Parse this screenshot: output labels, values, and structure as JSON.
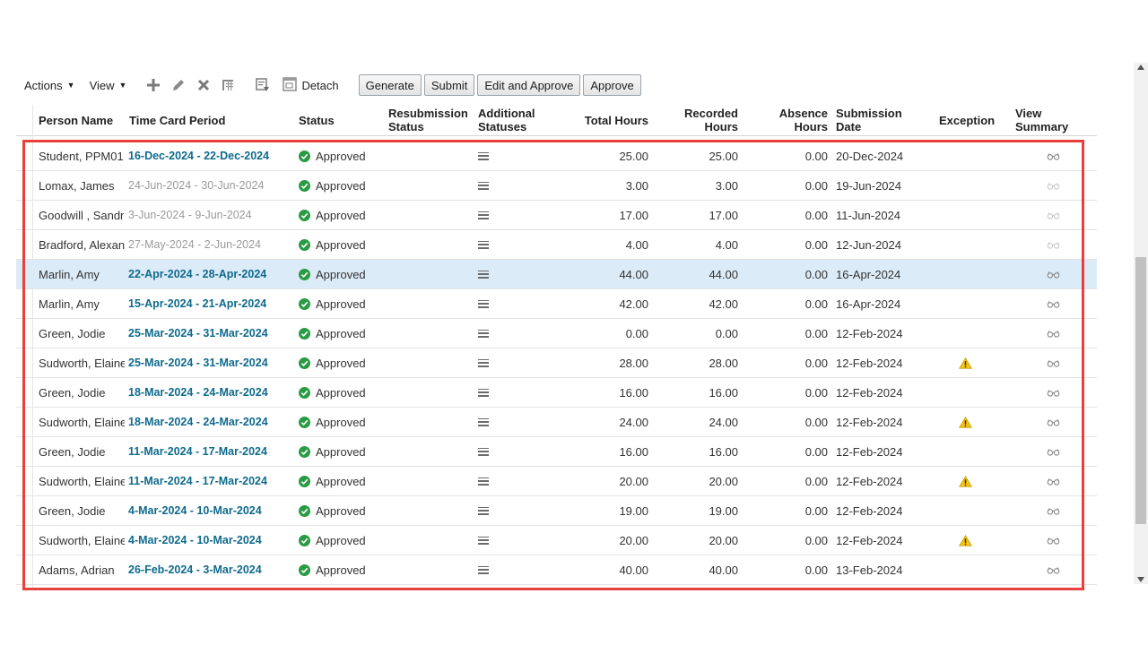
{
  "toolbar": {
    "actions_label": "Actions",
    "view_label": "View",
    "detach_label": "Detach",
    "buttons": {
      "generate": "Generate",
      "submit": "Submit",
      "edit_approve": "Edit and Approve",
      "approve": "Approve"
    },
    "icons": [
      "add-icon",
      "edit-icon",
      "delete-icon",
      "freeze-icon",
      "export-icon",
      "detach-icon"
    ]
  },
  "table": {
    "headers": {
      "person": "Person Name",
      "period": "Time Card Period",
      "status": "Status",
      "resub_1": "Resubmission",
      "resub_2": "Status",
      "addl_1": "Additional",
      "addl_2": "Statuses",
      "total": "Total Hours",
      "recorded_1": "Recorded",
      "recorded_2": "Hours",
      "absence_1": "Absence",
      "absence_2": "Hours",
      "subdate_1": "Submission",
      "subdate_2": "Date",
      "exception": "Exception",
      "summary": "View Summary"
    },
    "rows": [
      {
        "person": "Student, PPM01",
        "period": "16-Dec-2024 - 22-Dec-2024",
        "status": "Approved",
        "total": "25.00",
        "recorded": "25.00",
        "absence": "0.00",
        "date": "20-Dec-2024",
        "exception": false,
        "muted_period": false,
        "selected": false,
        "summary_dim": false
      },
      {
        "person": "Lomax, James",
        "period": "24-Jun-2024 - 30-Jun-2024",
        "status": "Approved",
        "total": "3.00",
        "recorded": "3.00",
        "absence": "0.00",
        "date": "19-Jun-2024",
        "exception": false,
        "muted_period": true,
        "selected": false,
        "summary_dim": true
      },
      {
        "person": "Goodwill , Sandra",
        "period": "3-Jun-2024 - 9-Jun-2024",
        "status": "Approved",
        "total": "17.00",
        "recorded": "17.00",
        "absence": "0.00",
        "date": "11-Jun-2024",
        "exception": false,
        "muted_period": true,
        "selected": false,
        "summary_dim": true
      },
      {
        "person": "Bradford, Alexander",
        "period": "27-May-2024 - 2-Jun-2024",
        "status": "Approved",
        "total": "4.00",
        "recorded": "4.00",
        "absence": "0.00",
        "date": "12-Jun-2024",
        "exception": false,
        "muted_period": true,
        "selected": false,
        "summary_dim": true
      },
      {
        "person": "Marlin, Amy",
        "period": "22-Apr-2024 - 28-Apr-2024",
        "status": "Approved",
        "total": "44.00",
        "recorded": "44.00",
        "absence": "0.00",
        "date": "16-Apr-2024",
        "exception": false,
        "muted_period": false,
        "selected": true,
        "summary_dim": false
      },
      {
        "person": "Marlin, Amy",
        "period": "15-Apr-2024 - 21-Apr-2024",
        "status": "Approved",
        "total": "42.00",
        "recorded": "42.00",
        "absence": "0.00",
        "date": "16-Apr-2024",
        "exception": false,
        "muted_period": false,
        "selected": false,
        "summary_dim": false
      },
      {
        "person": "Green, Jodie",
        "period": "25-Mar-2024 - 31-Mar-2024",
        "status": "Approved",
        "total": "0.00",
        "recorded": "0.00",
        "absence": "0.00",
        "date": "12-Feb-2024",
        "exception": false,
        "muted_period": false,
        "selected": false,
        "summary_dim": false
      },
      {
        "person": "Sudworth, Elaine",
        "period": "25-Mar-2024 - 31-Mar-2024",
        "status": "Approved",
        "total": "28.00",
        "recorded": "28.00",
        "absence": "0.00",
        "date": "12-Feb-2024",
        "exception": true,
        "muted_period": false,
        "selected": false,
        "summary_dim": false
      },
      {
        "person": "Green, Jodie",
        "period": "18-Mar-2024 - 24-Mar-2024",
        "status": "Approved",
        "total": "16.00",
        "recorded": "16.00",
        "absence": "0.00",
        "date": "12-Feb-2024",
        "exception": false,
        "muted_period": false,
        "selected": false,
        "summary_dim": false
      },
      {
        "person": "Sudworth, Elaine",
        "period": "18-Mar-2024 - 24-Mar-2024",
        "status": "Approved",
        "total": "24.00",
        "recorded": "24.00",
        "absence": "0.00",
        "date": "12-Feb-2024",
        "exception": true,
        "muted_period": false,
        "selected": false,
        "summary_dim": false
      },
      {
        "person": "Green, Jodie",
        "period": "11-Mar-2024 - 17-Mar-2024",
        "status": "Approved",
        "total": "16.00",
        "recorded": "16.00",
        "absence": "0.00",
        "date": "12-Feb-2024",
        "exception": false,
        "muted_period": false,
        "selected": false,
        "summary_dim": false
      },
      {
        "person": "Sudworth, Elaine",
        "period": "11-Mar-2024 - 17-Mar-2024",
        "status": "Approved",
        "total": "20.00",
        "recorded": "20.00",
        "absence": "0.00",
        "date": "12-Feb-2024",
        "exception": true,
        "muted_period": false,
        "selected": false,
        "summary_dim": false
      },
      {
        "person": "Green, Jodie",
        "period": "4-Mar-2024 - 10-Mar-2024",
        "status": "Approved",
        "total": "19.00",
        "recorded": "19.00",
        "absence": "0.00",
        "date": "12-Feb-2024",
        "exception": false,
        "muted_period": false,
        "selected": false,
        "summary_dim": false
      },
      {
        "person": "Sudworth, Elaine",
        "period": "4-Mar-2024 - 10-Mar-2024",
        "status": "Approved",
        "total": "20.00",
        "recorded": "20.00",
        "absence": "0.00",
        "date": "12-Feb-2024",
        "exception": true,
        "muted_period": false,
        "selected": false,
        "summary_dim": false
      },
      {
        "person": "Adams, Adrian",
        "period": "26-Feb-2024 - 3-Mar-2024",
        "status": "Approved",
        "total": "40.00",
        "recorded": "40.00",
        "absence": "0.00",
        "date": "13-Feb-2024",
        "exception": false,
        "muted_period": false,
        "selected": false,
        "summary_dim": false
      }
    ]
  },
  "colors": {
    "period_link": "#0f6a8c",
    "approved_check": "#2a9a44",
    "warning": "#f2c318",
    "selected_row": "#dcebf8",
    "highlight_box": "#e8403a"
  }
}
